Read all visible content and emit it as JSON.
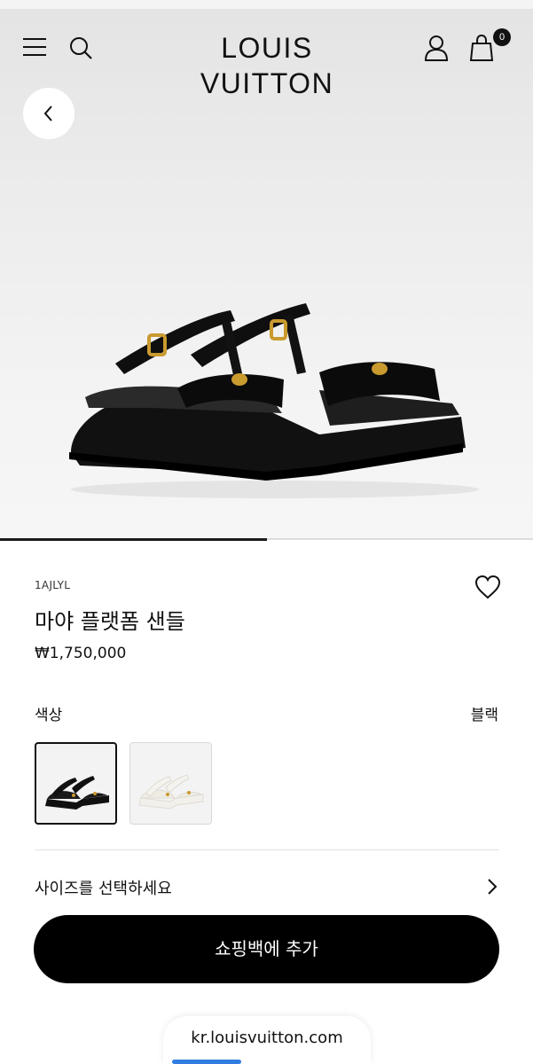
{
  "header": {
    "brand": "LOUIS VUITTON",
    "cart_count": "0",
    "icons": [
      "menu-icon",
      "search-icon",
      "account-icon",
      "shopping-bag-icon"
    ]
  },
  "gallery": {
    "progress": 0.5
  },
  "product": {
    "sku": "1AJLYL",
    "name": "마야 플랫폼 샌들",
    "price": "₩1,750,000"
  },
  "color": {
    "label": "색상",
    "selected": "블랙",
    "swatches": [
      "black",
      "white"
    ]
  },
  "size": {
    "prompt": "사이즈를 선택하세요"
  },
  "cta": {
    "label": "쇼핑백에 추가"
  },
  "browser": {
    "url": "kr.louisvuitton.com"
  },
  "colors": {
    "primary": "#000000",
    "hero_bg": "#ececec",
    "url_accent": "#2f7de1"
  }
}
